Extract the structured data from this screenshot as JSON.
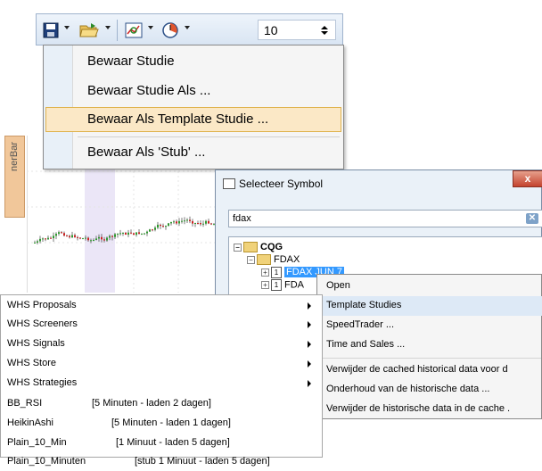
{
  "toolbar": {
    "save_icon": "floppy-disk-icon",
    "open_icon": "folder-open-icon",
    "chart_icon": "chart-refresh-icon",
    "clock_icon": "clock-icon",
    "spinner_value": "10"
  },
  "save_menu": {
    "items": [
      {
        "label": "Bewaar Studie"
      },
      {
        "label": "Bewaar Studie Als ..."
      },
      {
        "label": "Bewaar Als Template Studie ..."
      },
      {
        "label": "Bewaar Als 'Stub' ..."
      }
    ],
    "highlight_index": 2
  },
  "side_tab": {
    "label": "nerBar"
  },
  "symbol_dialog": {
    "title": "Selecteer Symbol",
    "close_label": "x",
    "search_value": "fdax",
    "tree": {
      "root": "CQG",
      "folder": "FDAX",
      "item1": "FDAX JUN 7",
      "item2": "FDA"
    }
  },
  "context_menu": {
    "items": [
      "Open",
      "Template Studies",
      "SpeedTrader ...",
      "Time and Sales ...",
      "Verwijder de cached historical data voor d",
      "Onderhoud van de historische data ...",
      "Verwijder de historische data in de cache ."
    ]
  },
  "studies_list": {
    "folders": [
      "WHS Proposals",
      "WHS Screeners",
      "WHS Signals",
      "WHS Store",
      "WHS Strategies"
    ],
    "entries": [
      {
        "name": "BB_RSI",
        "detail": "[5 Minuten - laden 2 dagen]"
      },
      {
        "name": "HeikinAshi",
        "detail": "[5 Minuten - laden 1 dagen]"
      },
      {
        "name": "Plain_10_Min",
        "detail": "[1 Minuut - laden 5 dagen]"
      },
      {
        "name": "Plain_10_Minuten",
        "detail": "[stub 1 Minuut - laden 5 dagen]"
      }
    ]
  },
  "colors": {
    "highlight_fill": "#fbe8c6",
    "highlight_border": "#e0b34f",
    "selection": "#3399ff",
    "candle_up": "#2e9a2e",
    "candle_down": "#cc2222"
  }
}
